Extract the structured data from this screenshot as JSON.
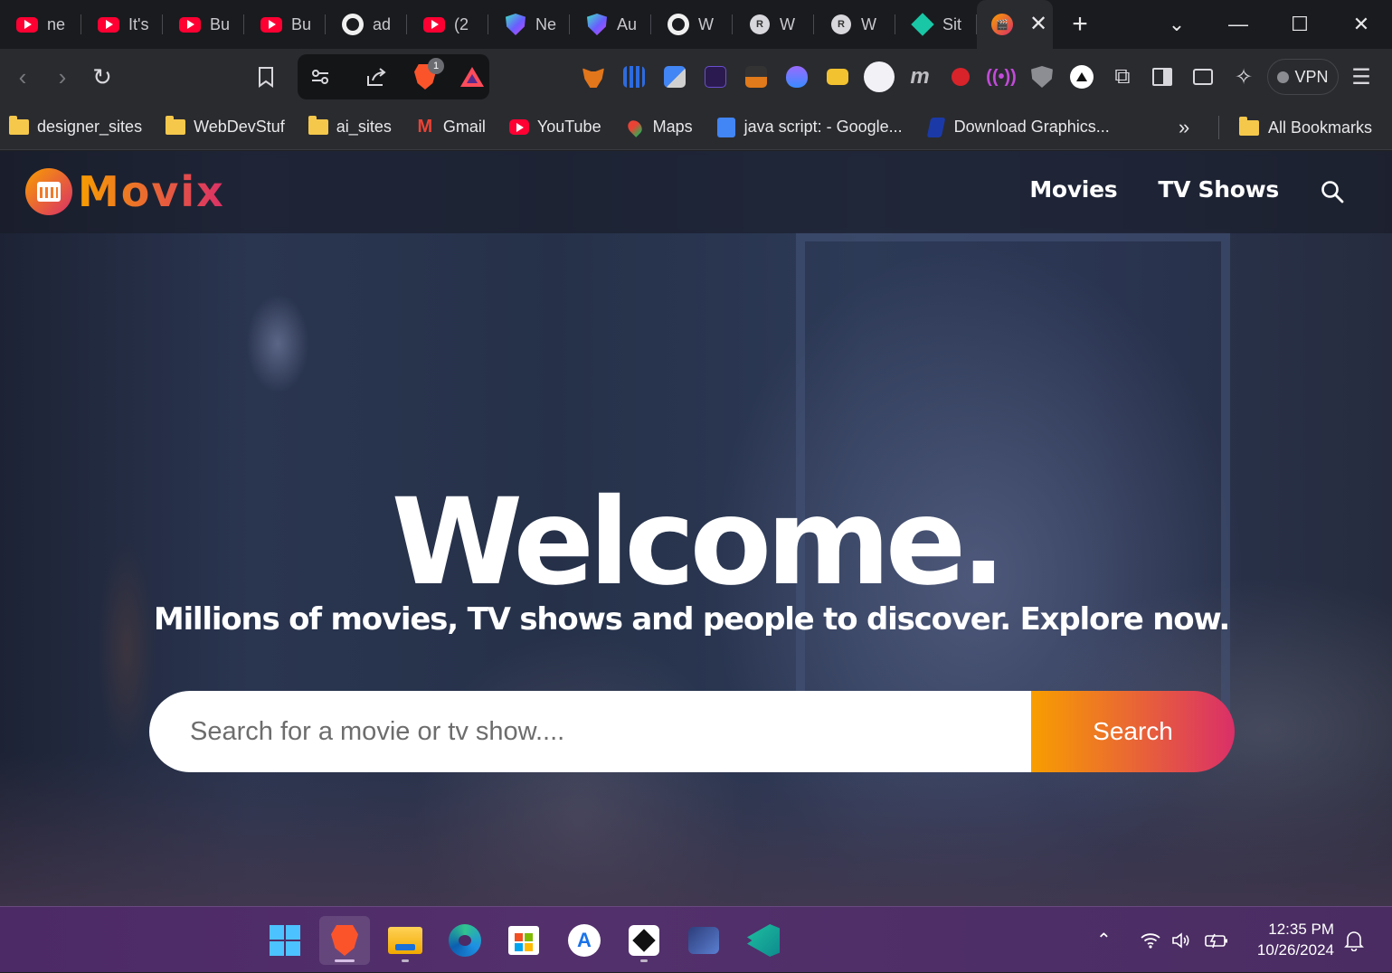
{
  "browser": {
    "tabs": [
      {
        "title": "ne",
        "icon": "youtube-icon"
      },
      {
        "title": "It's",
        "icon": "youtube-icon"
      },
      {
        "title": "Bu",
        "icon": "youtube-icon"
      },
      {
        "title": "Bu",
        "icon": "youtube-icon"
      },
      {
        "title": "ad",
        "icon": "github-icon"
      },
      {
        "title": "(2",
        "icon": "youtube-icon"
      },
      {
        "title": "Ne",
        "icon": "shield-icon"
      },
      {
        "title": "Au",
        "icon": "shield-icon"
      },
      {
        "title": "W",
        "icon": "github-icon"
      },
      {
        "title": "W",
        "icon": "r-avatar-icon"
      },
      {
        "title": "W",
        "icon": "r-avatar-icon"
      },
      {
        "title": "Sit",
        "icon": "diamond-icon"
      }
    ],
    "active_tab_icon": "movix-icon",
    "tab_favicon_letter": "R",
    "vpn_label": "VPN",
    "brave_badge": "1",
    "bookmarks": [
      {
        "label": "designer_sites",
        "icon": "folder-icon"
      },
      {
        "label": "WebDevStuf",
        "icon": "folder-icon"
      },
      {
        "label": "ai_sites",
        "icon": "folder-icon"
      },
      {
        "label": "Gmail",
        "icon": "gmail-icon"
      },
      {
        "label": "YouTube",
        "icon": "youtube-icon"
      },
      {
        "label": "Maps",
        "icon": "maps-icon"
      },
      {
        "label": "java script: - Google...",
        "icon": "docs-icon"
      },
      {
        "label": "Download Graphics...",
        "icon": "graphics-icon"
      }
    ],
    "all_bookmarks_label": "All Bookmarks"
  },
  "site": {
    "logo_text": "Movix",
    "nav": {
      "movies": "Movies",
      "tv_shows": "TV Shows"
    },
    "hero_title": "Welcome.",
    "hero_subtitle": "Millions of movies, TV shows and people to discover. Explore now.",
    "search_placeholder": "Search for a movie or tv show....",
    "search_button": "Search",
    "accent_start": "#f89e00",
    "accent_end": "#da2f68"
  },
  "taskbar": {
    "time": "12:35 PM",
    "date": "10/26/2024",
    "apps": [
      "start-icon",
      "brave-icon",
      "file-explorer-icon",
      "edge-icon",
      "store-icon",
      "app-store-icon",
      "cube-app-icon",
      "planet-app-icon",
      "vscode-icon"
    ]
  }
}
